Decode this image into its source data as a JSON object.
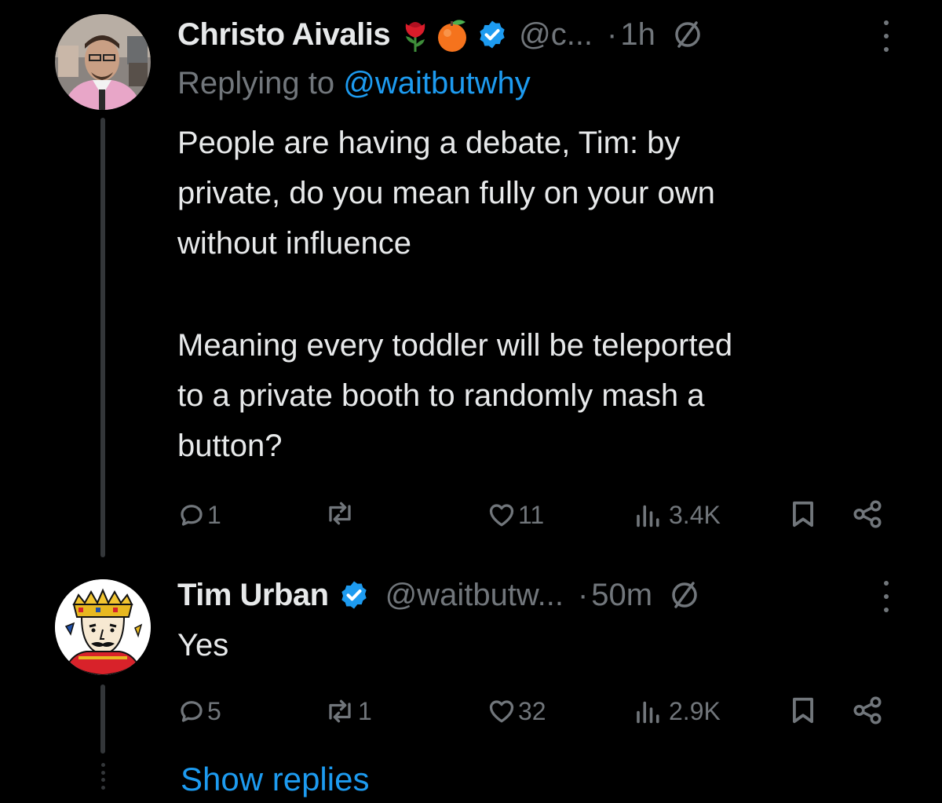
{
  "tweets": [
    {
      "author_name": "Christo Aivalis",
      "name_emojis": [
        "rose-emoji",
        "orange-emoji"
      ],
      "verified": true,
      "handle": "@c...",
      "separator": "·",
      "time": "1h",
      "replying_label": "Replying to",
      "replying_handle": "@waitbutwhy",
      "text_lines": [
        "People are having a debate, Tim: by",
        "private, do you mean fully on your own",
        "without influence",
        "Meaning every toddler will be teleported",
        "to a private booth to randomly mash a",
        "button?"
      ],
      "actions": {
        "replies": "1",
        "reposts": "",
        "likes": "11",
        "views": "3.4K"
      }
    },
    {
      "author_name": "Tim Urban",
      "verified": true,
      "handle": "@waitbutw...",
      "separator": "·",
      "time": "50m",
      "text_lines": [
        "Yes"
      ],
      "actions": {
        "replies": "5",
        "reposts": "1",
        "likes": "32",
        "views": "2.9K"
      }
    }
  ],
  "show_replies_label": "Show replies",
  "colors": {
    "background": "#000000",
    "text": "#e7e9ea",
    "muted": "#71767b",
    "link": "#1d9bf0",
    "verified": "#1d9bf0",
    "thread_line": "#333639"
  }
}
